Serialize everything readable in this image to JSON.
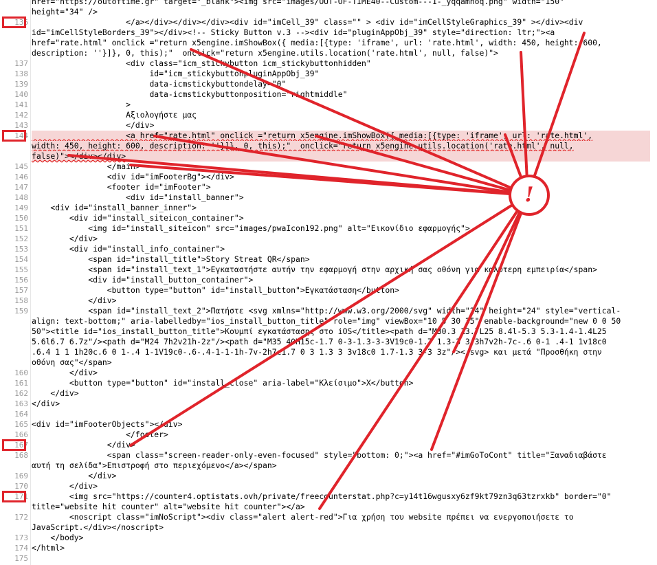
{
  "viewer": {
    "line_numbers": [
      "136",
      "137",
      "138",
      "139",
      "140",
      "141",
      "142",
      "143",
      "144",
      "145",
      "146",
      "147",
      "148",
      "149",
      "150",
      "151",
      "152",
      "153",
      "154",
      "155",
      "156",
      "157",
      "158",
      "159",
      "160",
      "161",
      "162",
      "163",
      "164",
      "165",
      "166",
      "167",
      "168",
      "169",
      "170",
      "171",
      "172",
      "173",
      "174",
      "175"
    ],
    "flagged_lines": [
      "136",
      "144",
      "167",
      "171"
    ]
  },
  "code": {
    "r0": "href=\"https://outoftime.gr\" target=\"_blank\"><img src=\"images/OUT-OF-TIME40--Custom---1-_yqqamhoq.png\" width=\"150\"",
    "r1": "height=\"34\" />",
    "r2": "                    </a></div></div></div><div id=\"imCell_39\" class=\"\" > <div id=\"imCellStyleGraphics_39\" ></div><div",
    "r3": "id=\"imCellStyleBorders_39\"></div><!-- Sticky Button v.3 --><div id=\"pluginAppObj_39\" style=\"direction: ltr;\"><a",
    "r4": "href=\"rate.html\" onclick =\"return x5engine.imShowBox({ media:[{type: 'iframe', url: 'rate.html', width: 450, height: 600,",
    "r5": "description: ''}]}, 0, this);\"  onclick=\"return x5engine.utils.location('rate.html', null, false)\">",
    "r6": "                    <div class=\"icm_stickybutton icm_stickybuttonhidden\"",
    "r7": "                         id=\"icm_stickybuttonpluginAppObj_39\"",
    "r8": "                         data-icmstickybuttondelay=\"0\"",
    "r9": "                         data-icmstickybuttonposition=\"rightmiddle\"",
    "r10": "                    >",
    "r11": "                    Αξιολογήστε μας",
    "r12": "                    </div>",
    "r13": "                    <a href=\"rate.html\" onclick =\"return x5engine.imShowBox({ media:[{type: 'iframe', url: 'rate.html',",
    "r14": "width: 450, height: 600, description: ''}]}, 0, this);\"  onclick=\"return x5engine.utils.location('rate.html', null,",
    "r15": "false)\"></div></div>",
    "r16": "                </main>",
    "r17": "                <div id=\"imFooterBg\"></div>",
    "r18": "                <footer id=\"imFooter\">",
    "r19": "                    <div id=\"install_banner\">",
    "r20": "    <div id=\"install_banner_inner\">",
    "r21": "        <div id=\"install_siteicon_container\">",
    "r22": "            <img id=\"install_siteicon\" src=\"images/pwaIcon192.png\" alt=\"Εικονίδιο εφαρμογής\">",
    "r23": "        </div>",
    "r24": "        <div id=\"install_info_container\">",
    "r25": "            <span id=\"install_title\">Story Streat QR</span>",
    "r26": "            <span id=\"install_text_1\">Εγκαταστήστε αυτήν την εφαρμογή στην αρχική σας οθόνη για καλύτερη εμπειρία</span>",
    "r27": "            <div id=\"install_button_container\">",
    "r28": "                <button type=\"button\" id=\"install_button\">Εγκατάσταση</button>",
    "r29": "            </div>",
    "r30": "            <span id=\"install_text_2\">Πατήστε <svg xmlns=\"http://www.w3.org/2000/svg\" width=\"24\" height=\"24\" style=\"vertical-",
    "r31": "align: text-bottom;\" aria-labelledby=\"ios_install_button_title\" role=\"img\" viewBox=\"10 5 30 35\" enable-background=\"new 0 0 50",
    "r32": "50\"><title id=\"ios_install_button_title\">Κουμπί εγκατάστασης στο iOS</title><path d=\"M30.3 13.7L25 8.4l-5.3 5.3-1.4-1.4L25",
    "r33": "5.6l6.7 6.7z\"/><path d=\"M24 7h2v21h-2z\"/><path d=\"M35 40H15c-1.7 0-3-1.3-3-3V19c0-1.7 1.3-3 3-3h7v2h-7c-.6 0-1 .4-1 1v18c0",
    "r34": ".6.4 1 1 1h20c.6 0 1-.4 1-1V19c0-.6-.4-1-1-1h-7v-2h7c1.7 0 3 1.3 3 3v18c0 1.7-1.3 3-3 3z\"/></svg> και μετά \"Προσθήκη στην",
    "r35": "οθόνη σας\"</span>",
    "r36": "        </div>",
    "r37": "        <button type=\"button\" id=\"install_close\" aria-label=\"Κλείσιμο\">X</button>",
    "r38": "    </div>",
    "r39": "</div>",
    "r40": "",
    "r41": "<div id=\"imFooterObjects\"></div>",
    "r42": "                    </footer>",
    "r43": "                </div>",
    "r44": "                <span class=\"screen-reader-only-even-focused\" style=\"bottom: 0;\"><a href=\"#imGoToCont\" title=\"Ξαναδιαβάστε",
    "r45": "αυτή τη σελίδα\">Επιστροφή στο περιεχόμενο</a></span>",
    "r46": "            </div>",
    "r47": "        </div>",
    "r48": "        <img src=\"https://counter4.optistats.ovh/private/freecounterstat.php?c=y14t16wgusxy6zf9kt79zn3q63tzrxkb\" border=\"0\"",
    "r49": "title=\"website hit counter\" alt=\"website hit counter\"></a>",
    "r50": "        <noscript class=\"imNoScript\"><div class=\"alert alert-red\">Για χρήση του website πρέπει να ενεργοποιήσετε το",
    "r51": "JavaScript.</div></noscript>",
    "r52": "    </body>",
    "r53": "</html>",
    "r54": ""
  },
  "annotation": {
    "icon": "warning-exclamation-icon",
    "symbol": "!",
    "color": "#e0242b"
  }
}
